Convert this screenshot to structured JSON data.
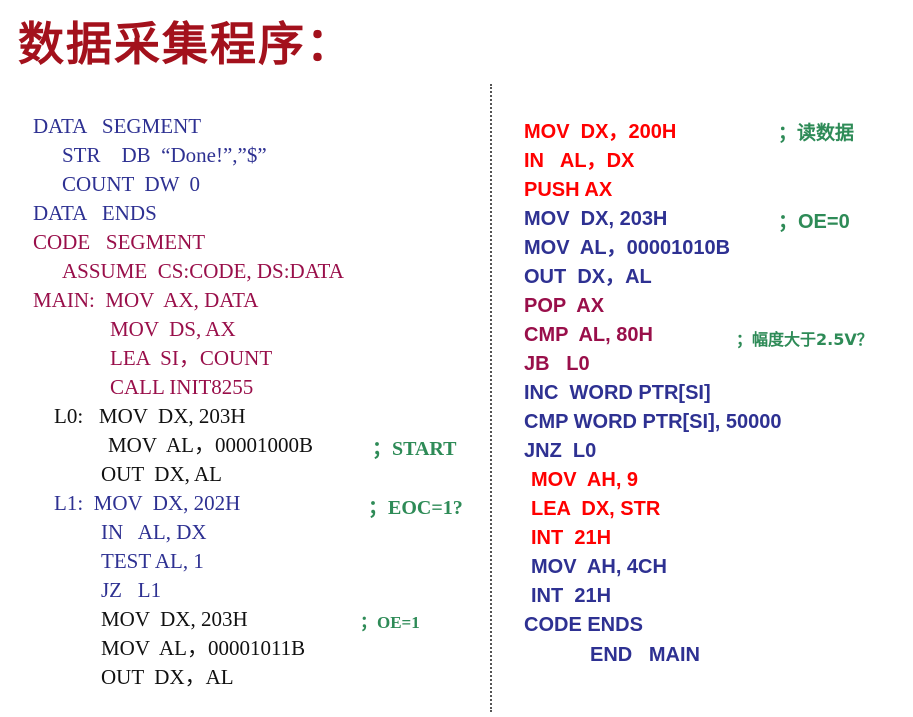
{
  "title": "数据采集程序：",
  "colors": {
    "title": "#a3111c",
    "blue": "#2e3192",
    "maroon": "#990f4a",
    "black": "#111111",
    "red": "#ff0000",
    "green": "#2e8b57"
  },
  "left_lines": [
    {
      "text": "DATA   SEGMENT",
      "color": "blue"
    },
    {
      "text": "STR    DB  “Done!”,”$”",
      "color": "blue"
    },
    {
      "text": "COUNT  DW  0",
      "color": "blue"
    },
    {
      "text": "DATA   ENDS",
      "color": "blue"
    },
    {
      "text": "CODE   SEGMENT",
      "color": "maroon"
    },
    {
      "text": "ASSUME  CS:CODE, DS:DATA",
      "color": "maroon"
    },
    {
      "text": "MAIN:  MOV  AX, DATA",
      "color": "maroon"
    },
    {
      "text": "MOV  DS, AX",
      "color": "maroon"
    },
    {
      "text": "LEA  SI，COUNT",
      "color": "maroon"
    },
    {
      "text": "CALL INIT8255",
      "color": "maroon"
    },
    {
      "text": "L0:   MOV  DX, 203H",
      "color": "black"
    },
    {
      "text": "MOV  AL，00001000B",
      "color": "black"
    },
    {
      "text": "OUT  DX, AL",
      "color": "black"
    },
    {
      "text": "L1:  MOV  DX, 202H",
      "color": "blue"
    },
    {
      "text": "IN   AL, DX",
      "color": "blue"
    },
    {
      "text": "TEST AL, 1",
      "color": "blue"
    },
    {
      "text": "JZ   L1",
      "color": "blue"
    },
    {
      "text": "MOV  DX, 203H",
      "color": "black"
    },
    {
      "text": "MOV  AL，00001011B",
      "color": "black"
    },
    {
      "text": "OUT  DX，AL",
      "color": "black"
    }
  ],
  "left_comments": {
    "start": "；START",
    "eoc": "；EOC=1?",
    "oe": "；OE=1"
  },
  "right_lines": [
    {
      "text": "MOV  DX，200H",
      "color": "red"
    },
    {
      "text": "IN   AL，DX",
      "color": "red"
    },
    {
      "text": "PUSH AX",
      "color": "red"
    },
    {
      "text": "MOV  DX, 203H",
      "color": "blue"
    },
    {
      "text": "MOV  AL，00001010B",
      "color": "blue"
    },
    {
      "text": "OUT  DX，AL",
      "color": "blue"
    },
    {
      "text": "POP  AX",
      "color": "maroon"
    },
    {
      "text": "CMP  AL, 80H",
      "color": "maroon"
    },
    {
      "text": "JB   L0",
      "color": "maroon"
    },
    {
      "text": "INC  WORD PTR[SI]",
      "color": "blue"
    },
    {
      "text": "CMP WORD PTR[SI], 50000",
      "color": "blue"
    },
    {
      "text": "JNZ  L0",
      "color": "blue"
    },
    {
      "text": "MOV  AH, 9",
      "color": "red"
    },
    {
      "text": "LEA  DX, STR",
      "color": "red"
    },
    {
      "text": "INT  21H",
      "color": "red"
    },
    {
      "text": "MOV  AH, 4CH",
      "color": "blue"
    },
    {
      "text": "INT  21H",
      "color": "blue"
    },
    {
      "text": "CODE ENDS",
      "color": "blue"
    },
    {
      "text": "END   MAIN",
      "color": "blue"
    }
  ],
  "right_comments": {
    "read": "；读数据",
    "oe0": "；OE=0",
    "amp": "；幅度大于2.5V？"
  }
}
